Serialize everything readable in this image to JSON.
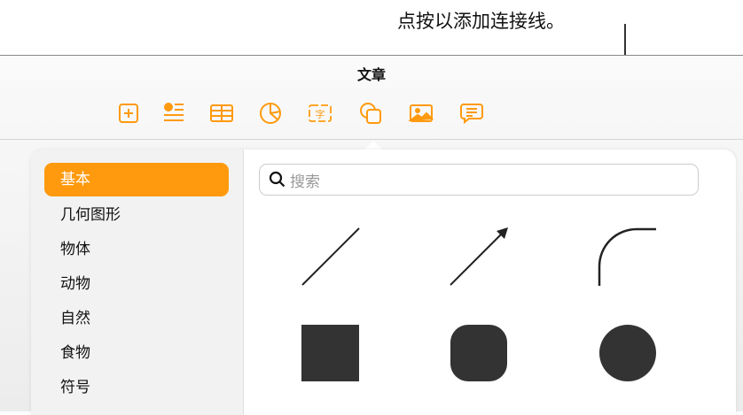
{
  "callout": "点按以添加连接线。",
  "window": {
    "title": "文章"
  },
  "toolbar": [
    {
      "icon": "add-page-icon"
    },
    {
      "icon": "list-add-icon"
    },
    {
      "icon": "table-icon"
    },
    {
      "icon": "chart-icon"
    },
    {
      "icon": "text-box-icon"
    },
    {
      "icon": "shapes-icon"
    },
    {
      "icon": "media-icon"
    },
    {
      "icon": "comment-icon"
    }
  ],
  "sidebar": {
    "items": [
      {
        "label": "基本",
        "selected": true
      },
      {
        "label": "几何图形"
      },
      {
        "label": "物体"
      },
      {
        "label": "动物"
      },
      {
        "label": "自然"
      },
      {
        "label": "食物"
      },
      {
        "label": "符号"
      }
    ]
  },
  "search": {
    "placeholder": "搜索"
  },
  "shapes": [
    "line",
    "arrow-line",
    "curved-connection-line",
    "square",
    "rounded-square",
    "circle"
  ],
  "colors": {
    "accent": "#ff9a0e",
    "shape": "#333333"
  }
}
